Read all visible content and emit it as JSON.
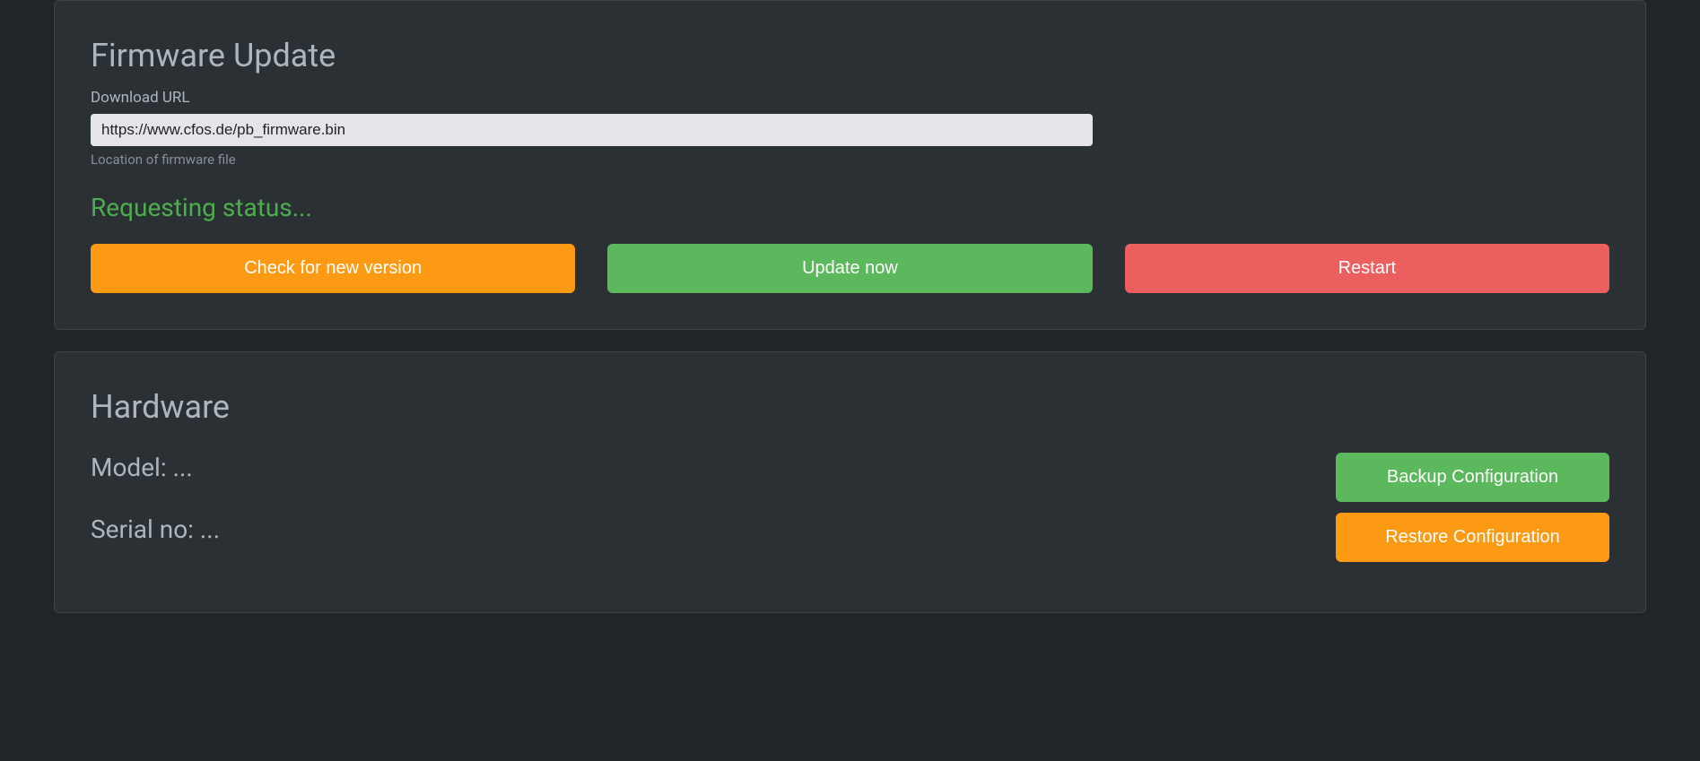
{
  "firmware": {
    "title": "Firmware Update",
    "url_label": "Download URL",
    "url_value": "https://www.cfos.de/pb_firmware.bin",
    "url_hint": "Location of firmware file",
    "status": "Requesting status...",
    "buttons": {
      "check": "Check for new version",
      "update": "Update now",
      "restart": "Restart"
    }
  },
  "hardware": {
    "title": "Hardware",
    "model_label": "Model: ",
    "model_value": "...",
    "serial_label": "Serial no: ",
    "serial_value": "...",
    "buttons": {
      "backup": "Backup Configuration",
      "restore": "Restore Configuration"
    }
  }
}
